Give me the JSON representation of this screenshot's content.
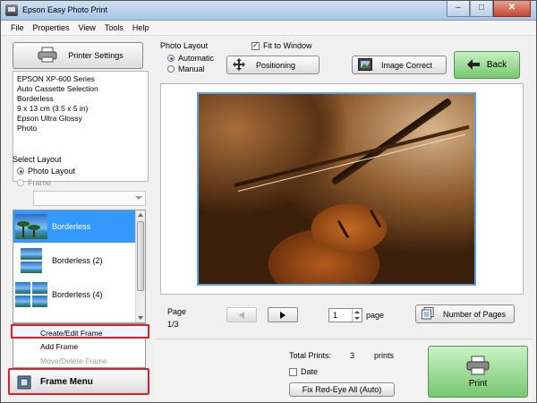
{
  "window": {
    "title": "Epson Easy Photo Print",
    "minimize": "–",
    "maximize": "□",
    "close": "✕"
  },
  "menu": [
    {
      "label": "File"
    },
    {
      "label": "Properties"
    },
    {
      "label": "View"
    },
    {
      "label": "Tools"
    },
    {
      "label": "Help"
    }
  ],
  "left": {
    "printer_settings_label": "Printer Settings",
    "printer_info": [
      "EPSON XP-600 Series",
      "Auto Cassette Selection",
      "Borderless",
      "9 x 13 cm (3.5 x 5 in)",
      "Epson Ultra Glossy",
      "Photo"
    ],
    "select_layout_title": "Select Layout",
    "layout_modes": [
      {
        "label": "Photo Layout",
        "selected": true,
        "enabled": true
      },
      {
        "label": "Frame",
        "selected": false,
        "enabled": false
      }
    ],
    "layouts": [
      {
        "label": "Borderless",
        "selected": true
      },
      {
        "label": "Borderless (2)",
        "selected": false
      },
      {
        "label": "Borderless (4)",
        "selected": false
      }
    ],
    "frame_menu_items": [
      {
        "label": "Create/Edit Frame",
        "highlighted": true,
        "enabled": true
      },
      {
        "label": "Add Frame",
        "highlighted": false,
        "enabled": true
      },
      {
        "label": "Move/Delete Frame",
        "highlighted": false,
        "enabled": false
      }
    ],
    "frame_menu_label": "Frame Menu"
  },
  "top": {
    "photo_layout_title": "Photo Layout",
    "layout_radios": [
      {
        "label": "Automatic",
        "selected": true
      },
      {
        "label": "Manual",
        "selected": false
      }
    ],
    "fit_to_window_label": "Fit to Window",
    "fit_to_window_checked": true,
    "positioning_label": "Positioning",
    "image_correct_label": "Image Correct",
    "back_label": "Back"
  },
  "preview": {
    "page_label": "Page",
    "page_count": "1/3",
    "page_value": "1",
    "page_word": "page",
    "number_of_pages_label": "Number of Pages"
  },
  "bottom": {
    "total_prints_label": "Total Prints:",
    "total_prints_value": "3",
    "total_prints_unit": "prints",
    "date_label": "Date",
    "date_checked": false,
    "red_eye_label": "Fix Red-Eye All (Auto)",
    "print_label": "Print"
  },
  "colors": {
    "selection": "#3399ff",
    "highlight_outline": "#d8222a",
    "action_green": "#79c772"
  }
}
